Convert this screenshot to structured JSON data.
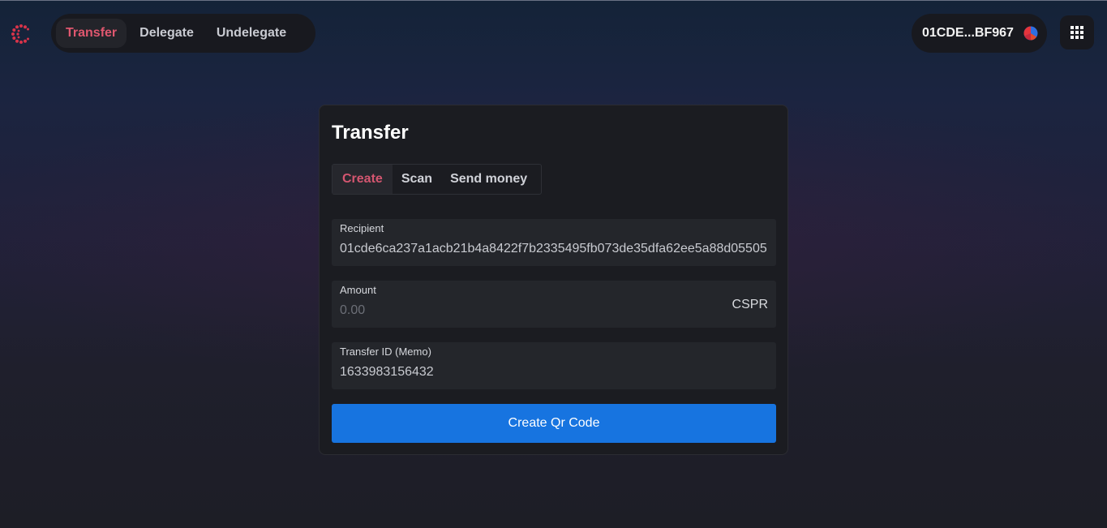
{
  "nav": {
    "items": [
      {
        "label": "Transfer",
        "active": true
      },
      {
        "label": "Delegate",
        "active": false
      },
      {
        "label": "Undelegate",
        "active": false
      }
    ]
  },
  "account": {
    "short_key": "01CDE...BF967",
    "avatar_icon": "account-avatar-icon"
  },
  "apps_icon": "apps-grid-icon",
  "logo_icon": "casper-logo-icon",
  "colors": {
    "accent": "#e0576f",
    "primary_button": "#1774e0",
    "card_bg": "#1b1c21",
    "field_bg": "#24262b"
  },
  "card": {
    "title": "Transfer",
    "tabs": [
      {
        "label": "Create",
        "active": true
      },
      {
        "label": "Scan",
        "active": false
      },
      {
        "label": "Send money",
        "active": false
      }
    ],
    "recipient": {
      "label": "Recipient",
      "value": "01cde6ca237a1acb21b4a8422f7b2335495fb073de35dfa62ee5a88d05505"
    },
    "amount": {
      "label": "Amount",
      "value": "",
      "placeholder": "0.00",
      "unit": "CSPR"
    },
    "memo": {
      "label": "Transfer ID (Memo)",
      "value": "1633983156432"
    },
    "submit_label": "Create Qr Code"
  }
}
